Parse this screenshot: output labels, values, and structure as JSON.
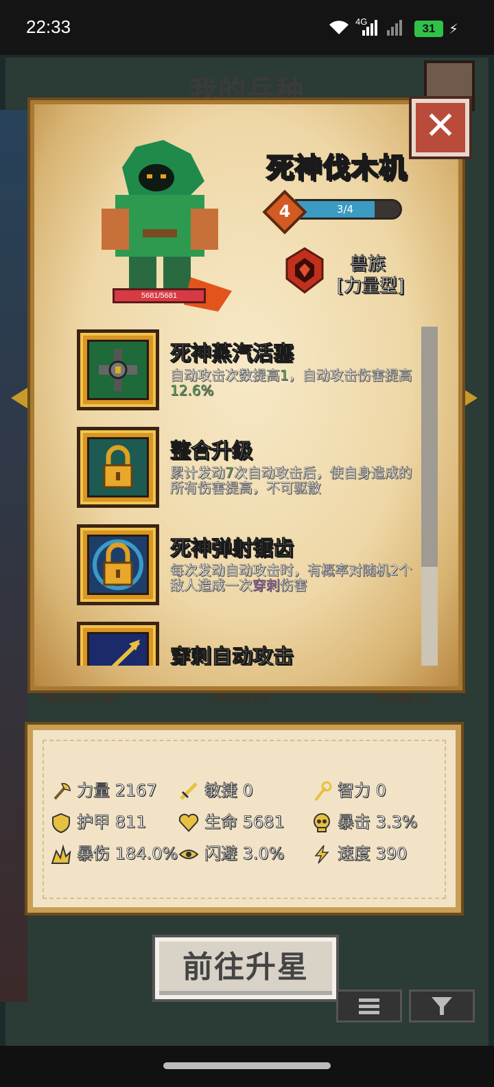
{
  "status_bar": {
    "time": "22:33",
    "network": "4G",
    "battery": "31"
  },
  "screen_title": "我的兵种",
  "unit": {
    "name": "死神伐木机",
    "hp_text": "5681/5681",
    "level": "4",
    "xp_text": "3/4",
    "xp_progress": 0.75,
    "race": "兽族",
    "race_type": "[力量型]"
  },
  "skills": [
    {
      "title": "死神蒸汽活塞",
      "desc_parts": [
        "自动攻击次数提高",
        "1",
        "，自动攻击伤害提高",
        "12.6%"
      ],
      "icon": "steam-piston-icon"
    },
    {
      "title": "整合升级",
      "desc_parts": [
        "累计发动",
        "7",
        "次自动攻击后，使自身造成的所有伤害提高，不可驱散"
      ],
      "icon": "lock-icon"
    },
    {
      "title": "死神弹射锯齿",
      "desc_parts": [
        "每次发动自动攻击时，有概率对随机2个敌人造成一次",
        "穿刺",
        "伤害"
      ],
      "icon": "lock-icon"
    },
    {
      "title": "穿刺自动攻击",
      "icon": "arrow-icon"
    }
  ],
  "background_labels": [
    "嗜血之母",
    "驯熊师",
    "熊骑士"
  ],
  "stats": [
    {
      "label": "力量",
      "value": "2167",
      "icon": "axe-icon"
    },
    {
      "label": "敏捷",
      "value": "0",
      "icon": "sword-icon"
    },
    {
      "label": "智力",
      "value": "0",
      "icon": "staff-icon"
    },
    {
      "label": "护甲",
      "value": "811",
      "icon": "shield-icon"
    },
    {
      "label": "生命",
      "value": "5681",
      "icon": "heart-icon"
    },
    {
      "label": "暴击",
      "value": "3.3%",
      "icon": "skull-icon"
    },
    {
      "label": "暴伤",
      "value": "184.0%",
      "icon": "burst-icon"
    },
    {
      "label": "闪避",
      "value": "3.0%",
      "icon": "eye-icon"
    },
    {
      "label": "速度",
      "value": "390",
      "icon": "lightning-icon"
    }
  ],
  "buttons": {
    "go_upgrade": "前往升星"
  },
  "colors": {
    "parchment": "#f2e3c7",
    "gold_frame": "#d99622",
    "close_red": "#b94b3a",
    "highlight_green": "#4fb34c",
    "highlight_purple": "#b35fd6",
    "xp_blue": "#3b9bc2"
  }
}
